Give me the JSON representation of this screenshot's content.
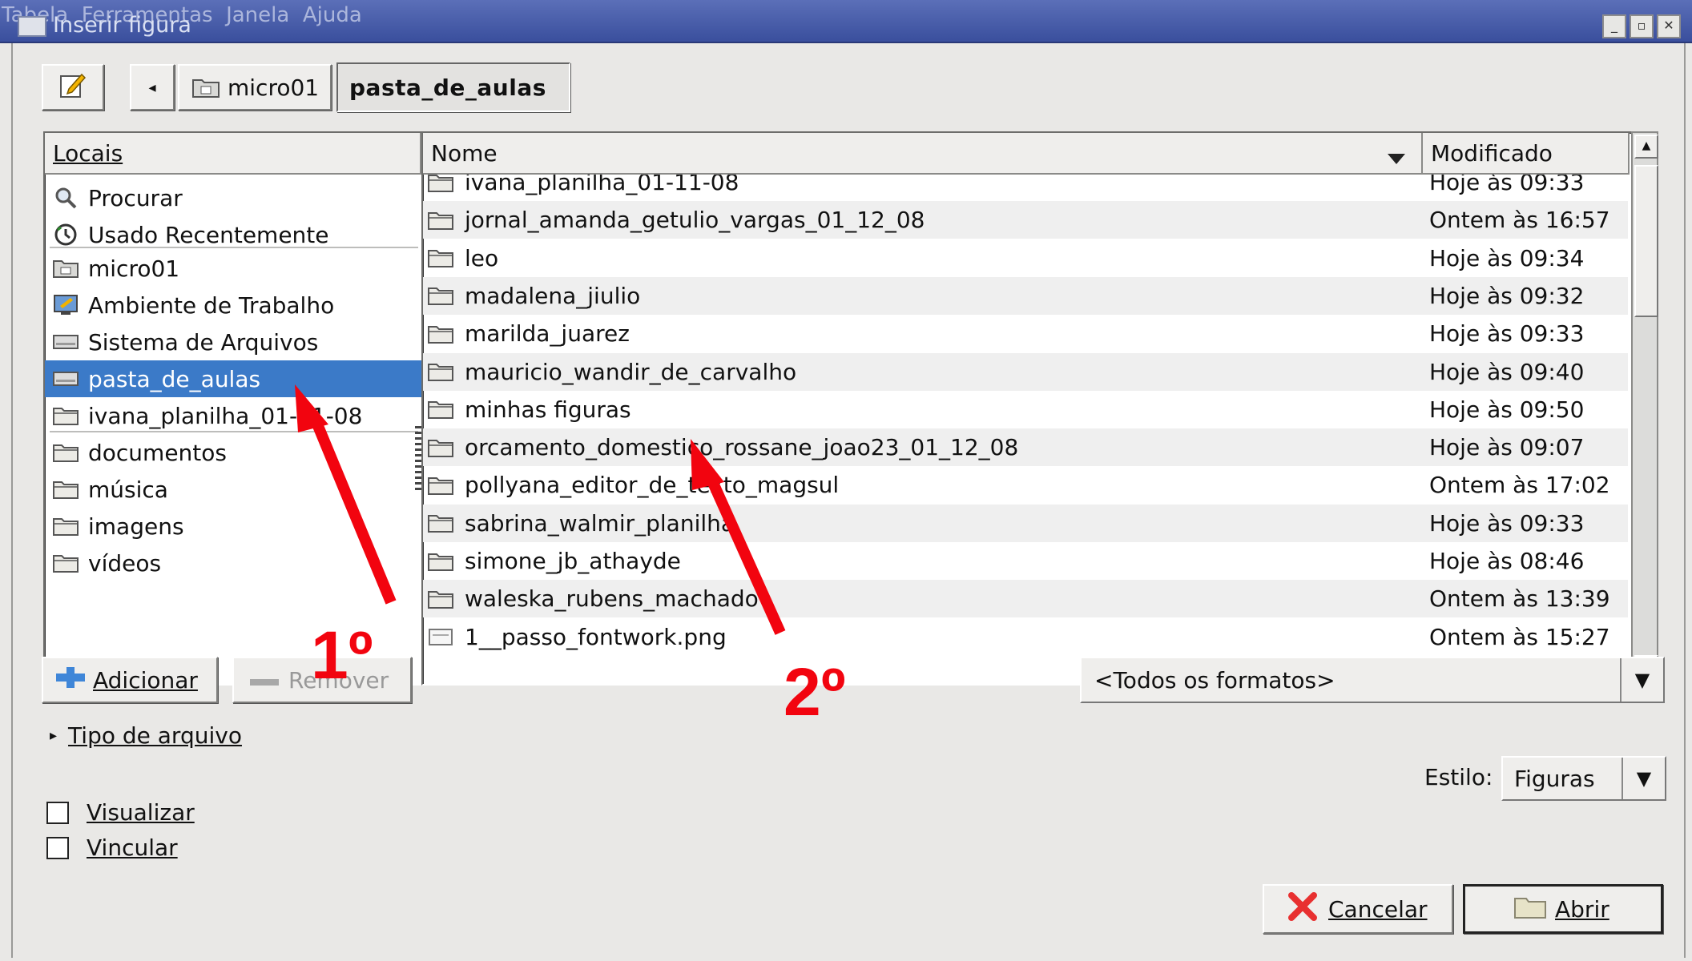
{
  "window": {
    "menubar_ghost": "Tabela  Ferramentas  Janela  Ajuda",
    "title": "Inserir figura",
    "buttons": [
      "_",
      "▫",
      "✕"
    ]
  },
  "path_bar": {
    "back_glyph": "◂",
    "crumbs": [
      "micro01",
      "pasta_de_aulas"
    ]
  },
  "places": {
    "header": "Locais",
    "items": [
      {
        "label": "Procurar",
        "icon": "search-icon"
      },
      {
        "label": "Usado Recentemente",
        "icon": "recent-icon"
      },
      {
        "label": "micro01",
        "icon": "home-folder-icon"
      },
      {
        "label": "Ambiente de Trabalho",
        "icon": "desktop-icon"
      },
      {
        "label": "Sistema de Arquivos",
        "icon": "drive-icon"
      },
      {
        "label": "pasta_de_aulas",
        "icon": "drive-icon",
        "selected": true
      },
      {
        "label": "ivana_planilha_01-11-08",
        "icon": "folder-icon"
      },
      {
        "label": "documentos",
        "icon": "folder-icon"
      },
      {
        "label": "música",
        "icon": "folder-icon"
      },
      {
        "label": "imagens",
        "icon": "folder-icon"
      },
      {
        "label": "vídeos",
        "icon": "folder-icon"
      }
    ]
  },
  "files": {
    "col_name": "Nome",
    "col_modified": "Modificado",
    "rows": [
      {
        "name": "ivana_planilha_01-11-08",
        "modified": "Hoje às 09:33"
      },
      {
        "name": "jornal_amanda_getulio_vargas_01_12_08",
        "modified": "Ontem às 16:57"
      },
      {
        "name": "leo",
        "modified": "Hoje às 09:34"
      },
      {
        "name": "madalena_jiulio",
        "modified": "Hoje às 09:32"
      },
      {
        "name": "marilda_juarez",
        "modified": "Hoje às 09:33"
      },
      {
        "name": "mauricio_wandir_de_carvalho",
        "modified": "Hoje às 09:40"
      },
      {
        "name": "minhas figuras",
        "modified": "Hoje às 09:50"
      },
      {
        "name": "orcamento_domestico_rossane_joao23_01_12_08",
        "modified": "Hoje às 09:07"
      },
      {
        "name": "pollyana_editor_de_texto_magsul",
        "modified": "Ontem às 17:02"
      },
      {
        "name": "sabrina_walmir_planilha",
        "modified": "Hoje às 09:33"
      },
      {
        "name": "simone_jb_athayde",
        "modified": "Hoje às 08:46"
      },
      {
        "name": "waleska_rubens_machado",
        "modified": "Ontem às 13:39"
      },
      {
        "name": "1__passo_fontwork.png",
        "modified": "Ontem às 15:27",
        "is_file": true
      }
    ]
  },
  "controls": {
    "add_label": "Adicionar",
    "remove_label": "Remover",
    "formats_value": "<Todos os formatos>",
    "file_type_label": "Tipo de arquivo",
    "style_label": "Estilo:",
    "style_value": "Figuras",
    "preview_label": "Visualizar",
    "link_label": "Vincular",
    "cancel_label": "Cancelar",
    "open_label": "Abrir"
  },
  "annotations": {
    "first": "1º",
    "second": "2º",
    "color": "#f2040f"
  }
}
